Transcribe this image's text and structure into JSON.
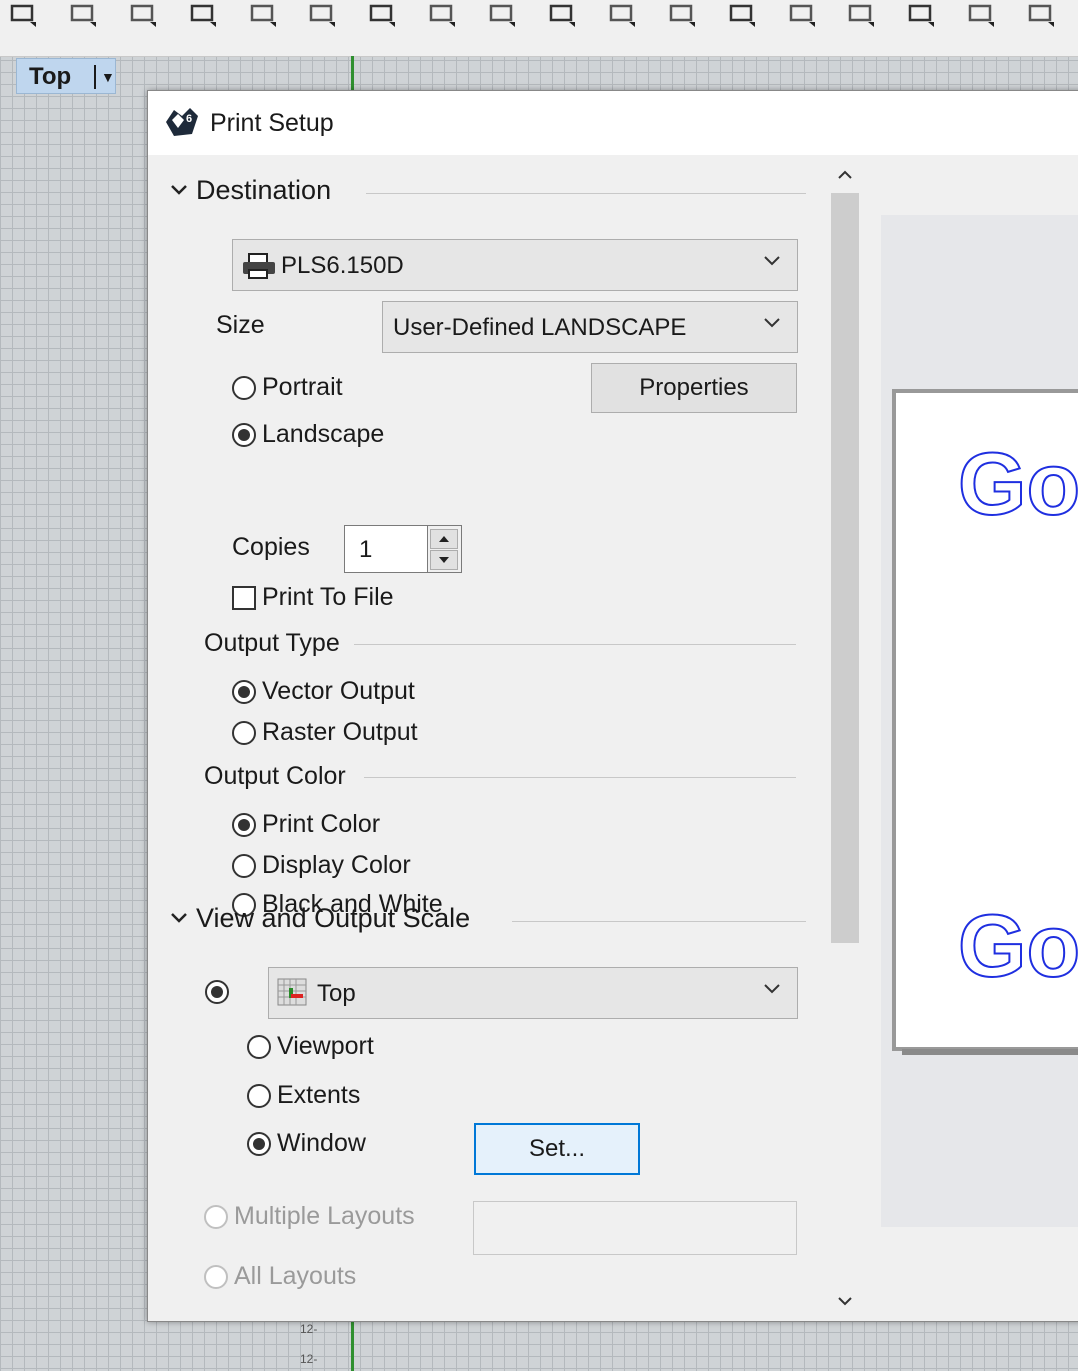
{
  "viewport": {
    "label": "Top",
    "axis_ticks": [
      "12-",
      "12-"
    ]
  },
  "toolbar": {
    "icons": [
      "open-icon",
      "print-icon",
      "new-page-icon",
      "cut-icon",
      "copy-icon",
      "paste-icon",
      "undo-icon",
      "pan-icon",
      "rotate-icon",
      "zoom-icon",
      "zoom-window-icon",
      "zoom-extents-icon",
      "zoom-selected-icon",
      "zoom-dynamic-icon",
      "viewport-layout-icon",
      "shade-icon",
      "render-icon",
      "sphere-icon"
    ]
  },
  "dialog": {
    "title": "Print Setup",
    "destination": {
      "heading": "Destination",
      "printer": "PLS6.150D",
      "size_label": "Size",
      "size_value": "User-Defined LANDSCAPE",
      "orientation": {
        "portrait": "Portrait",
        "landscape": "Landscape",
        "selected": "landscape"
      },
      "properties_button": "Properties",
      "copies_label": "Copies",
      "copies_value": "1",
      "print_to_file": "Print To File"
    },
    "output_type": {
      "heading": "Output Type",
      "vector": "Vector Output",
      "raster": "Raster Output",
      "selected": "vector"
    },
    "output_color": {
      "heading": "Output Color",
      "print": "Print Color",
      "display": "Display Color",
      "bw": "Black and White",
      "selected": "print"
    },
    "view_scale": {
      "heading": "View and Output Scale",
      "view_value": "Top",
      "viewport": "Viewport",
      "extents": "Extents",
      "window": "Window",
      "selected": "window",
      "set_button": "Set...",
      "multiple_layouts": "Multiple Layouts",
      "all_layouts": "All Layouts"
    },
    "preview": {
      "text_top": "Go",
      "text_bottom": "Go"
    }
  }
}
